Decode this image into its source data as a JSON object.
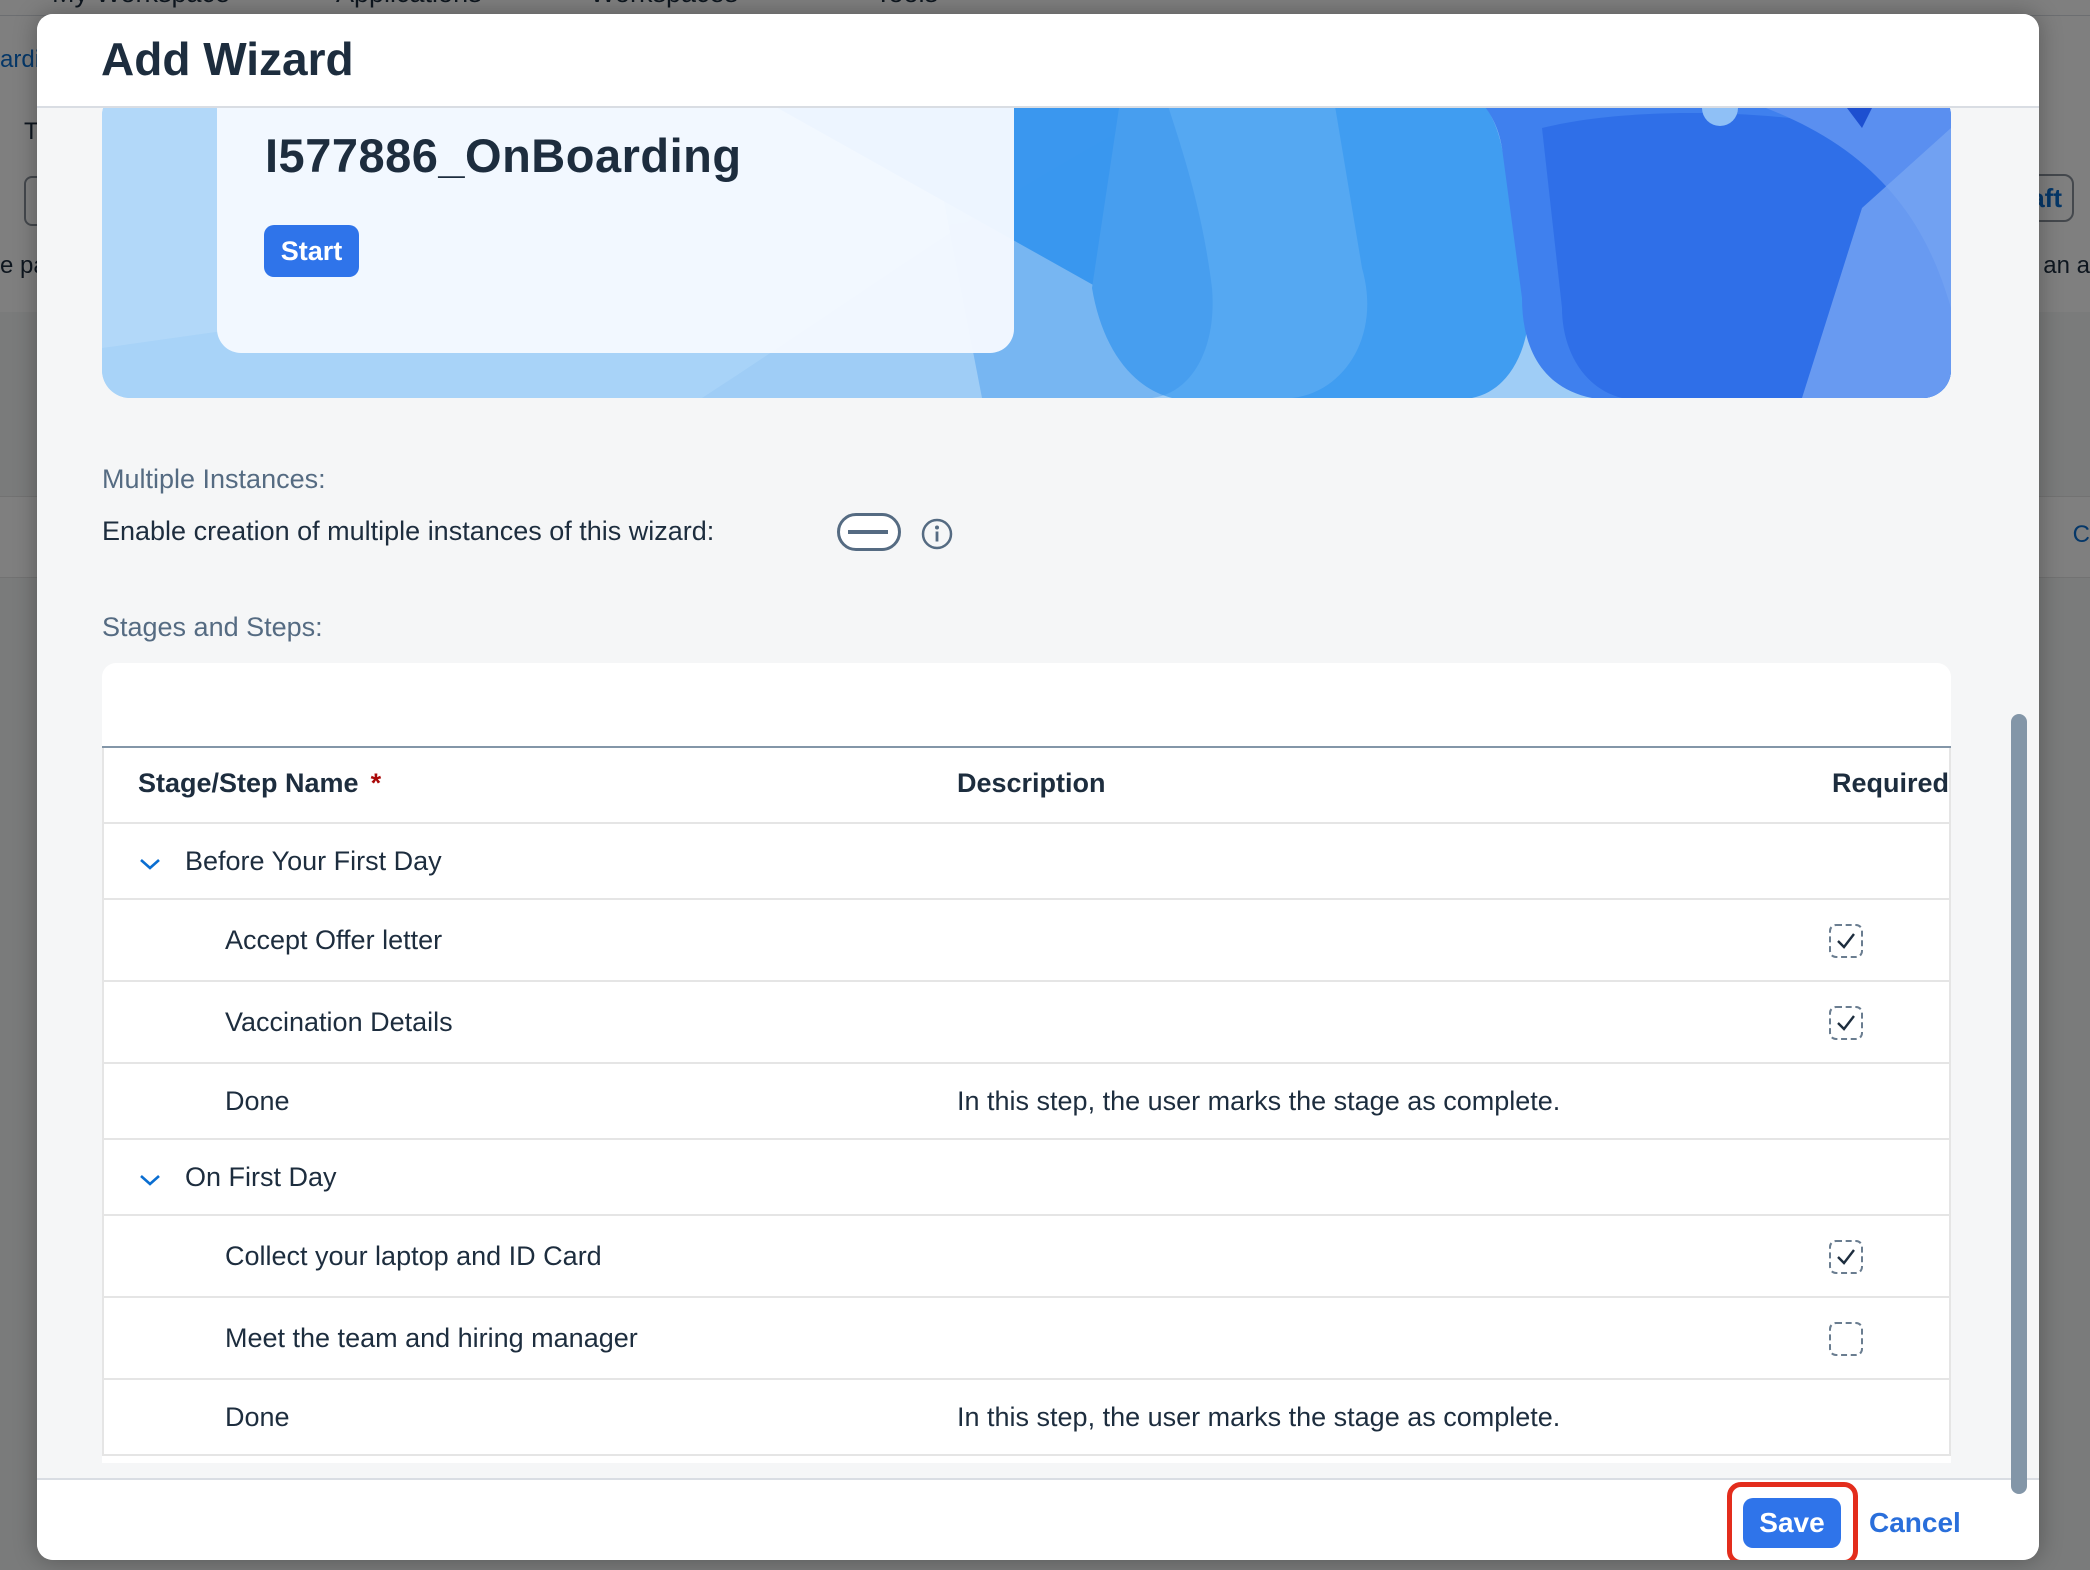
{
  "background": {
    "nav": [
      "My Workspace",
      "Applications",
      "Workspaces",
      "Tools"
    ],
    "fragments": {
      "left_link": "ardi",
      "left_t": "T",
      "left_text": "e pa",
      "right_btn": "aft",
      "right_text": "an a",
      "right_c": "C"
    }
  },
  "dialog": {
    "title": "Add Wizard",
    "banner": {
      "wizard_name": "I577886_OnBoarding",
      "start_label": "Start"
    },
    "multiple_instances": {
      "section_label": "Multiple Instances:",
      "toggle_label": "Enable creation of multiple instances of this wizard:",
      "enabled": false
    },
    "stages": {
      "section_label": "Stages and Steps:",
      "columns": {
        "name": "Stage/Step Name",
        "required_marker": "*",
        "description": "Description",
        "required": "Required"
      },
      "rows": [
        {
          "type": "stage",
          "name": "Before Your First Day",
          "description": "",
          "required": null
        },
        {
          "type": "step",
          "name": "Accept Offer letter",
          "description": "",
          "required": true
        },
        {
          "type": "step",
          "name": "Vaccination Details",
          "description": "",
          "required": true
        },
        {
          "type": "step",
          "name": "Done",
          "description": "In this step, the user marks the stage as complete.",
          "required": null
        },
        {
          "type": "stage",
          "name": "On First Day",
          "description": "",
          "required": null
        },
        {
          "type": "step",
          "name": "Collect your laptop and ID Card",
          "description": "",
          "required": true
        },
        {
          "type": "step",
          "name": "Meet the team and hiring manager",
          "description": "",
          "required": false
        },
        {
          "type": "step",
          "name": "Done",
          "description": "In this step, the user marks the stage as complete.",
          "required": null
        }
      ]
    },
    "footer": {
      "save_label": "Save",
      "cancel_label": "Cancel"
    }
  },
  "colors": {
    "accent": "#2f74ea",
    "highlight": "#e32d1c",
    "link": "#2a6fdb"
  }
}
